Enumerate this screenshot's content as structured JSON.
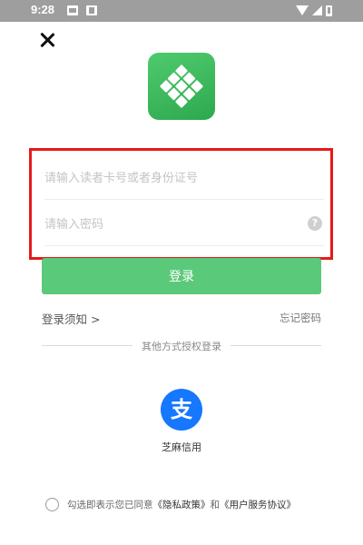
{
  "status_bar": {
    "time": "9:28",
    "icons": [
      "notification-icon",
      "photo-icon",
      "wifi-icon",
      "signal-icon",
      "battery-icon"
    ]
  },
  "header": {
    "close_icon": "close-icon"
  },
  "logo": {
    "icon": "app-logo-icon",
    "color": "#3cb95c"
  },
  "form": {
    "card_placeholder": "请输入读者卡号或者身份证号",
    "card_value": "",
    "password_placeholder": "请输入密码",
    "password_value": "",
    "help_glyph": "?",
    "highlight_color": "#e81919"
  },
  "login": {
    "button_label": "登录",
    "color": "#5bc97a"
  },
  "links": {
    "notice": "登录须知 >",
    "forgot_password": "忘记密码"
  },
  "third_party": {
    "divider_text": "其他方式授权登录",
    "provider_glyph": "支",
    "provider_label": "芝麻信用",
    "provider_color": "#1677ff"
  },
  "agreement": {
    "prefix": "勾选即表示您已同意",
    "privacy": "《隐私政策》",
    "and": "和",
    "terms": "《用户服务协议》",
    "checked": false
  }
}
